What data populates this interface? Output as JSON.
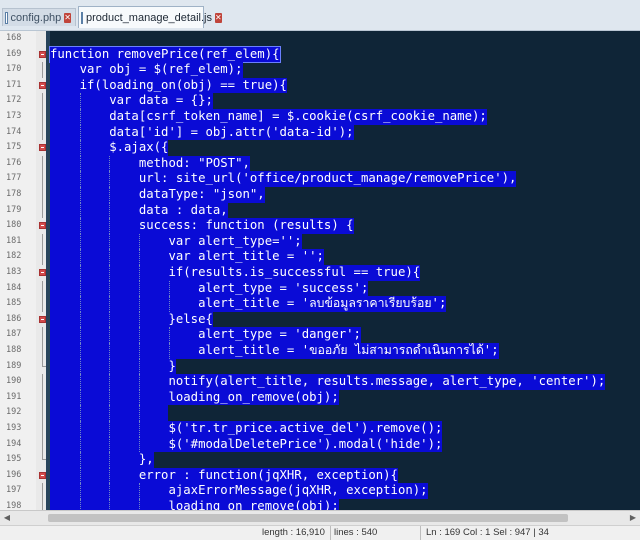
{
  "tabs": [
    {
      "label": "config.php",
      "active": false,
      "icon": "file-icon"
    },
    {
      "label": "product_manage_detail.js",
      "active": true,
      "icon": "file-icon"
    }
  ],
  "editor": {
    "lines": [
      {
        "num": "168",
        "text": "",
        "indent": 0,
        "fold": ""
      },
      {
        "num": "169",
        "text": "function removePrice(ref_elem){",
        "indent": 0,
        "fold": "start"
      },
      {
        "num": "170",
        "text": "var obj = $(ref_elem);",
        "indent": 1,
        "fold": "line"
      },
      {
        "num": "171",
        "text": "if(loading_on(obj) == true){",
        "indent": 1,
        "fold": "start"
      },
      {
        "num": "172",
        "text": "var data = {};",
        "indent": 2,
        "fold": "line"
      },
      {
        "num": "173",
        "text": "data[csrf_token_name] = $.cookie(csrf_cookie_name);",
        "indent": 2,
        "fold": "line"
      },
      {
        "num": "174",
        "text": "data['id'] = obj.attr('data-id');",
        "indent": 2,
        "fold": "line"
      },
      {
        "num": "175",
        "text": "$.ajax({",
        "indent": 2,
        "fold": "start"
      },
      {
        "num": "176",
        "text": "method: \"POST\",",
        "indent": 3,
        "fold": "line"
      },
      {
        "num": "177",
        "text": "url: site_url('office/product_manage/removePrice'),",
        "indent": 3,
        "fold": "line"
      },
      {
        "num": "178",
        "text": "dataType: \"json\",",
        "indent": 3,
        "fold": "line"
      },
      {
        "num": "179",
        "text": "data : data,",
        "indent": 3,
        "fold": "line"
      },
      {
        "num": "180",
        "text": "success: function (results) {",
        "indent": 3,
        "fold": "start"
      },
      {
        "num": "181",
        "text": "var alert_type='';",
        "indent": 4,
        "fold": "line"
      },
      {
        "num": "182",
        "text": "var alert_title = '';",
        "indent": 4,
        "fold": "line"
      },
      {
        "num": "183",
        "text": "if(results.is_successful == true){",
        "indent": 4,
        "fold": "start"
      },
      {
        "num": "184",
        "text": "alert_type = 'success';",
        "indent": 5,
        "fold": "line"
      },
      {
        "num": "185",
        "text": "alert_title = 'ลบข้อมูลราคาเรียบร้อย';",
        "indent": 5,
        "fold": "line"
      },
      {
        "num": "186",
        "text": "}else{",
        "indent": 4,
        "fold": "start"
      },
      {
        "num": "187",
        "text": "alert_type = 'danger';",
        "indent": 5,
        "fold": "line"
      },
      {
        "num": "188",
        "text": "alert_title = 'ขออภัย ไม่สามารถดำเนินการได้';",
        "indent": 5,
        "fold": "line"
      },
      {
        "num": "189",
        "text": "}",
        "indent": 4,
        "fold": "end"
      },
      {
        "num": "190",
        "text": "notify(alert_title, results.message, alert_type, 'center');",
        "indent": 4,
        "fold": "line"
      },
      {
        "num": "191",
        "text": "loading_on_remove(obj);",
        "indent": 4,
        "fold": "line"
      },
      {
        "num": "192",
        "text": "",
        "indent": 4,
        "fold": "line"
      },
      {
        "num": "193",
        "text": "$('tr.tr_price.active_del').remove();",
        "indent": 4,
        "fold": "line"
      },
      {
        "num": "194",
        "text": "$('#modalDeletePrice').modal('hide');",
        "indent": 4,
        "fold": "line"
      },
      {
        "num": "195",
        "text": "},",
        "indent": 3,
        "fold": "end"
      },
      {
        "num": "196",
        "text": "error : function(jqXHR, exception){",
        "indent": 3,
        "fold": "start"
      },
      {
        "num": "197",
        "text": "ajaxErrorMessage(jqXHR, exception);",
        "indent": 4,
        "fold": "line"
      },
      {
        "num": "198",
        "text": "loading_on_remove(obj);",
        "indent": 4,
        "fold": "line"
      }
    ]
  },
  "status": {
    "length": "length : 16,910",
    "lines": "lines : 540",
    "position": "Ln : 169    Col : 1    Sel : 947 | 34"
  },
  "colors": {
    "selection": "#0a0bd6",
    "text": "#ffffff",
    "fold_marker": "#d14a4a",
    "editor_bg": "#0f2537"
  }
}
